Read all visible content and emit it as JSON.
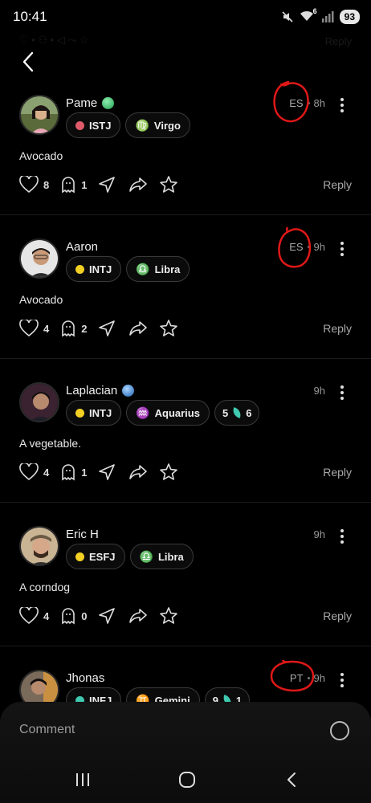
{
  "status": {
    "time": "10:41",
    "battery": "93",
    "wifi_badge": "6"
  },
  "ghost_header": {
    "title": "... ago",
    "right_label": "Reply"
  },
  "comments": [
    {
      "name": "Pame",
      "badge_color": "#2ecc71",
      "lang": "ES",
      "time": "8h",
      "mbti": "ISTJ",
      "mbti_color": "#e05a6a",
      "zodiac": "Virgo",
      "zodiac_icon": "♍",
      "text": "Avocado",
      "likes": "8",
      "ghosts": "1",
      "reply": "Reply",
      "extra": ""
    },
    {
      "name": "Aaron",
      "badge_color": "",
      "lang": "ES",
      "time": "9h",
      "mbti": "INTJ",
      "mbti_color": "#f2d024",
      "zodiac": "Libra",
      "zodiac_icon": "♎",
      "text": "Avocado",
      "likes": "4",
      "ghosts": "2",
      "reply": "Reply",
      "extra": ""
    },
    {
      "name": "Laplacian",
      "badge_color": "#2f7fd9",
      "lang": "",
      "time": "9h",
      "mbti": "INTJ",
      "mbti_color": "#f2d024",
      "zodiac": "Aquarius",
      "zodiac_icon": "♒",
      "text": "A vegetable.",
      "likes": "4",
      "ghosts": "1",
      "reply": "Reply",
      "extra": {
        "left": "5",
        "right": "6"
      }
    },
    {
      "name": "Eric H",
      "badge_color": "",
      "lang": "",
      "time": "9h",
      "mbti": "ESFJ",
      "mbti_color": "#f2d024",
      "zodiac": "Libra",
      "zodiac_icon": "♎",
      "text": "A corndog",
      "likes": "4",
      "ghosts": "0",
      "reply": "Reply",
      "extra": ""
    },
    {
      "name": "Jhonas",
      "badge_color": "",
      "lang": "PT",
      "time": "9h",
      "mbti": "INFJ",
      "mbti_color": "#3fc9b0",
      "zodiac": "Gemini",
      "zodiac_icon": "♊",
      "text": "",
      "likes": "",
      "ghosts": "",
      "reply": "",
      "extra": {
        "left": "9",
        "right": "1"
      }
    }
  ],
  "composer": {
    "placeholder": "Comment"
  },
  "colors": {
    "background": "#000000",
    "annotation": "#e01818",
    "accent_teal": "#3fc9b0"
  },
  "icons": [
    "back-icon",
    "heart-icon",
    "ghost-icon",
    "send-icon",
    "share-icon",
    "star-icon",
    "more-icon",
    "recents-icon",
    "home-icon",
    "nav-back-icon"
  ]
}
